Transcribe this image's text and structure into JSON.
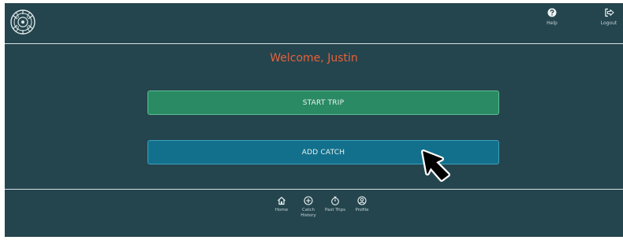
{
  "header": {
    "help_label": "Help",
    "logout_label": "Logout"
  },
  "main": {
    "welcome": "Welcome, Justin",
    "start_trip_label": "START TRIP",
    "add_catch_label": "ADD CATCH"
  },
  "nav": {
    "items": [
      {
        "label": "Home",
        "icon": "home-icon"
      },
      {
        "label": "Catch History",
        "icon": "plus-circle-icon"
      },
      {
        "label": "Past Trips",
        "icon": "stopwatch-icon"
      },
      {
        "label": "Profile",
        "icon": "user-circle-icon"
      }
    ]
  },
  "colors": {
    "background": "#24454e",
    "welcome": "#e8603a",
    "start_trip": "#2a8a63",
    "add_catch": "#13708c"
  }
}
